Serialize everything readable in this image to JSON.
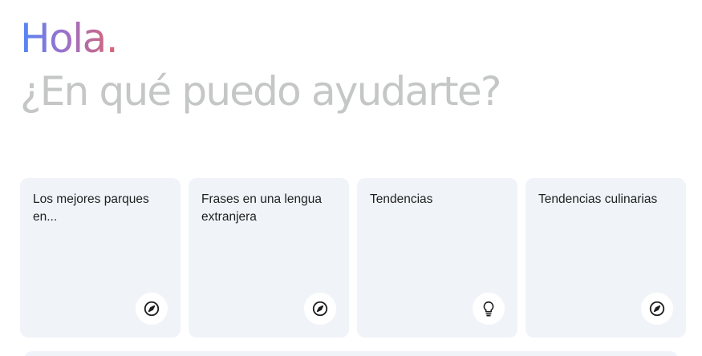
{
  "greeting": "Hola.",
  "subtitle": "¿En qué puedo ayudarte?",
  "cards": [
    {
      "text": "Los mejores parques en...",
      "icon": "compass-icon"
    },
    {
      "text": "Frases en una lengua extranjera",
      "icon": "compass-icon"
    },
    {
      "text": "Tendencias",
      "icon": "lightbulb-icon"
    },
    {
      "text": "Tendencias culinarias",
      "icon": "compass-icon"
    }
  ],
  "colors": {
    "greeting_gradient": [
      "#4f86f7",
      "#9b72cb",
      "#d96570"
    ],
    "subtitle": "#c4c7c5",
    "card_bg": "#f0f4f9",
    "text": "#1f1f1f"
  }
}
